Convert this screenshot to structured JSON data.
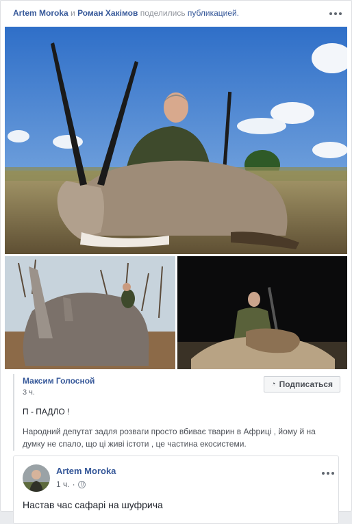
{
  "share": {
    "actor1": "Artem Moroka",
    "conj": "и",
    "actor2": "Роман Хакімов",
    "action": "поделились",
    "object": "публикацией."
  },
  "quoted": {
    "author": "Максим Голосной",
    "time": "3 ч.",
    "subscribe_label": "Подписаться",
    "headline": "П - ПАДЛО !",
    "body": "Народний депутат задля розваги просто вбиває тварин в Африці , йому й на думку не спало, що ці живі істоти , це частина екосистеми."
  },
  "inner_post": {
    "author": "Artem Moroka",
    "time": "1 ч.",
    "text": "Настав час сафарі на шуфрича"
  },
  "icons": {
    "more": "more-options-icon",
    "rss": "rss-icon",
    "privacy": "globe-icon"
  },
  "colors": {
    "link": "#365899",
    "meta": "#90949c",
    "sky": "#5b8fd6",
    "grass": "#8a7d56",
    "night": "#0b0b0c"
  }
}
